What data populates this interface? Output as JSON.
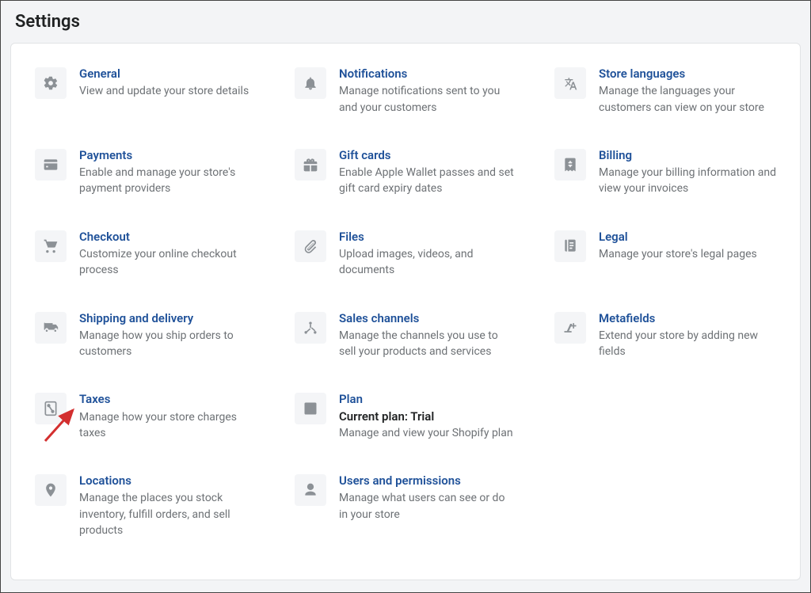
{
  "page_title": "Settings",
  "colors": {
    "link": "#1f5199",
    "icon_bg": "#f4f5f7",
    "icon_fg": "#8c9196",
    "text_muted": "#6d7175"
  },
  "tiles": {
    "general": {
      "title": "General",
      "desc": "View and update your store details"
    },
    "notifications": {
      "title": "Notifications",
      "desc": "Manage notifications sent to you and your customers"
    },
    "languages": {
      "title": "Store languages",
      "desc": "Manage the languages your customers can view on your store"
    },
    "payments": {
      "title": "Payments",
      "desc": "Enable and manage your store's payment providers"
    },
    "giftcards": {
      "title": "Gift cards",
      "desc": "Enable Apple Wallet passes and set gift card expiry dates"
    },
    "billing": {
      "title": "Billing",
      "desc": "Manage your billing information and view your invoices"
    },
    "checkout": {
      "title": "Checkout",
      "desc": "Customize your online checkout process"
    },
    "files": {
      "title": "Files",
      "desc": "Upload images, videos, and documents"
    },
    "legal": {
      "title": "Legal",
      "desc": "Manage your store's legal pages"
    },
    "shipping": {
      "title": "Shipping and delivery",
      "desc": "Manage how you ship orders to customers"
    },
    "saleschannels": {
      "title": "Sales channels",
      "desc": "Manage the channels you use to sell your products and services"
    },
    "metafields": {
      "title": "Metafields",
      "desc": "Extend your store by adding new fields"
    },
    "taxes": {
      "title": "Taxes",
      "desc": "Manage how your store charges taxes"
    },
    "plan": {
      "title": "Plan",
      "subtitle": "Current plan: Trial",
      "desc": "Manage and view your Shopify plan"
    },
    "locations": {
      "title": "Locations",
      "desc": "Manage the places you stock inventory, fulfill orders, and sell products"
    },
    "users": {
      "title": "Users and permissions",
      "desc": "Manage what users can see or do in your store"
    }
  },
  "annotation": {
    "arrow_target": "taxes"
  }
}
